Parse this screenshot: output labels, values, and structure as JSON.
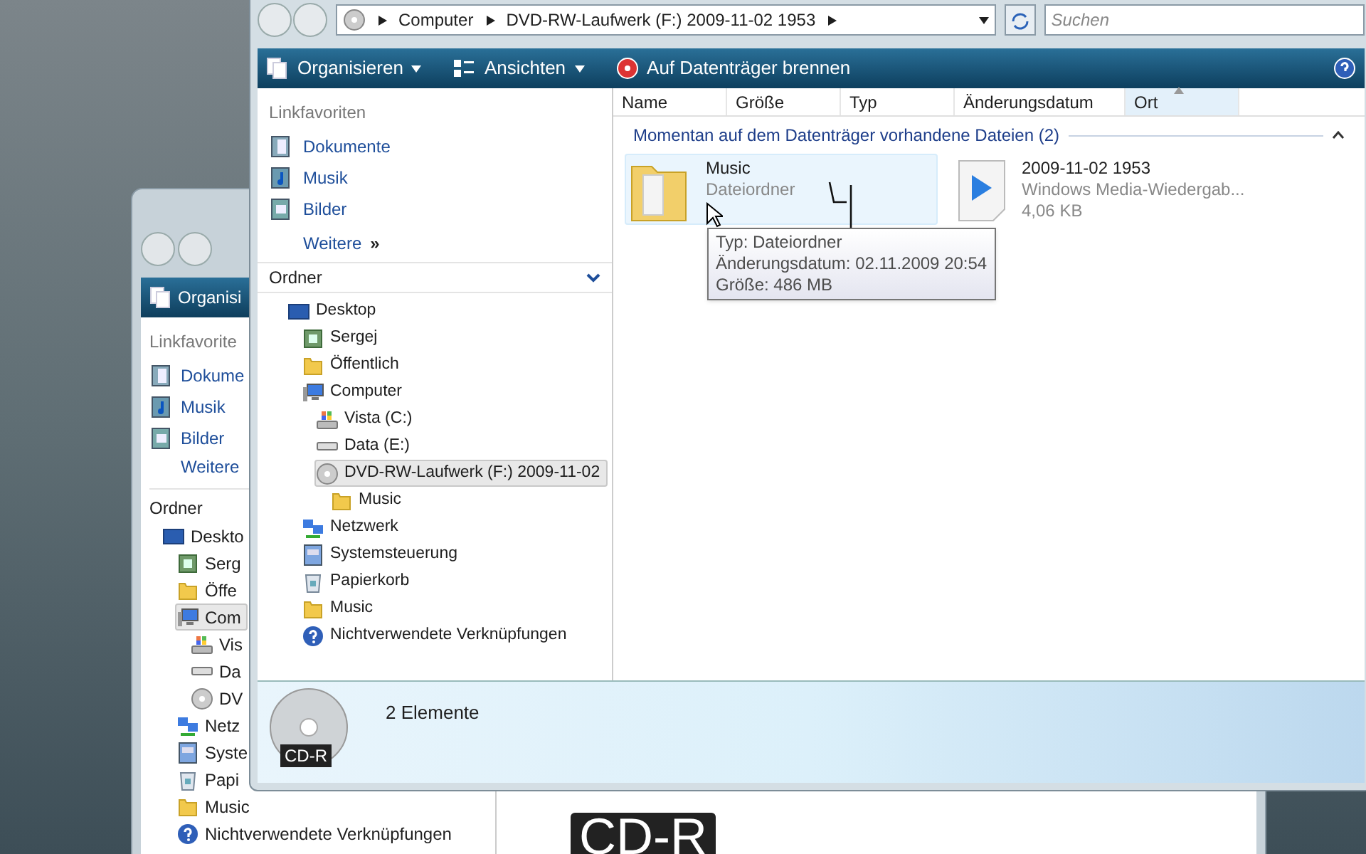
{
  "back_window": {
    "toolbar_button": "Organisi",
    "favorites_title": "Linkfavorite",
    "favorites": [
      {
        "label": "Dokume",
        "kind": "documents"
      },
      {
        "label": "Musik",
        "kind": "music"
      },
      {
        "label": "Bilder",
        "kind": "pictures"
      }
    ],
    "more": "Weitere",
    "folders_title": "Ordner",
    "tree": [
      {
        "label": "Deskto",
        "kind": "desktop",
        "selected": false,
        "children": [
          {
            "label": "Serg",
            "kind": "user",
            "selected": false
          },
          {
            "label": "Öffe",
            "kind": "folder",
            "selected": false
          },
          {
            "label": "Com",
            "kind": "computer",
            "selected": true,
            "children": [
              {
                "label": "Vis",
                "kind": "system-drive",
                "selected": false
              },
              {
                "label": "Da",
                "kind": "drive",
                "selected": false
              },
              {
                "label": "DV",
                "kind": "disc",
                "selected": false
              }
            ]
          },
          {
            "label": "Netz",
            "kind": "network",
            "selected": false
          },
          {
            "label": "Syste",
            "kind": "control-panel",
            "selected": false
          },
          {
            "label": "Papi",
            "kind": "recycle-bin",
            "selected": false
          },
          {
            "label": "Music",
            "kind": "folder",
            "selected": false
          },
          {
            "label": "Nichtverwendete Verknüpfungen",
            "kind": "help",
            "selected": false
          }
        ]
      }
    ],
    "drive_label": "CD-R"
  },
  "front_window": {
    "address": [
      "Computer",
      "DVD-RW-Laufwerk (F:) 2009-11-02 1953"
    ],
    "search": {
      "placeholder": "Suchen"
    },
    "toolbar": [
      {
        "label": "Organisieren",
        "kind": "organize",
        "dropdown": true
      },
      {
        "label": "Ansichten",
        "kind": "views",
        "dropdown": true
      },
      {
        "label": "Auf Datenträger brennen",
        "kind": "burn",
        "dropdown": false
      }
    ],
    "favorites_title": "Linkfavoriten",
    "favorites": [
      {
        "label": "Dokumente",
        "kind": "documents"
      },
      {
        "label": "Musik",
        "kind": "music"
      },
      {
        "label": "Bilder",
        "kind": "pictures"
      }
    ],
    "more": "Weitere",
    "more_glyph": "»",
    "folders_title": "Ordner",
    "tree": [
      {
        "label": "Desktop",
        "kind": "desktop",
        "selected": false,
        "children": [
          {
            "label": "Sergej",
            "kind": "user",
            "selected": false
          },
          {
            "label": "Öffentlich",
            "kind": "folder",
            "selected": false
          },
          {
            "label": "Computer",
            "kind": "computer",
            "selected": false,
            "children": [
              {
                "label": "Vista (C:)",
                "kind": "system-drive",
                "selected": false
              },
              {
                "label": "Data (E:)",
                "kind": "drive",
                "selected": false
              },
              {
                "label": "DVD-RW-Laufwerk (F:) 2009-11-02",
                "kind": "disc",
                "selected": true,
                "children": [
                  {
                    "label": "Music",
                    "kind": "folder",
                    "selected": false
                  }
                ]
              }
            ]
          },
          {
            "label": "Netzwerk",
            "kind": "network",
            "selected": false
          },
          {
            "label": "Systemsteuerung",
            "kind": "control-panel",
            "selected": false
          },
          {
            "label": "Papierkorb",
            "kind": "recycle-bin",
            "selected": false
          },
          {
            "label": "Music",
            "kind": "folder",
            "selected": false
          },
          {
            "label": "Nichtverwendete Verknüpfungen",
            "kind": "help",
            "selected": false
          }
        ]
      }
    ],
    "columns": [
      {
        "label": "Name",
        "sorted": false
      },
      {
        "label": "Größe",
        "sorted": false
      },
      {
        "label": "Typ",
        "sorted": false
      },
      {
        "label": "Änderungsdatum",
        "sorted": false
      },
      {
        "label": "Ort",
        "sorted": true
      }
    ],
    "group": {
      "title": "Momentan auf dem Datenträger vorhandene Dateien (2)",
      "expanded": true
    },
    "files": [
      {
        "name": "Music",
        "kind": "folder",
        "details": [
          "Dateiordner"
        ],
        "hovered": true
      },
      {
        "name": "2009-11-02 1953",
        "kind": "media",
        "details": [
          "Windows Media-Wiedergab...",
          "4,06 KB"
        ],
        "hovered": false
      }
    ],
    "tooltip": [
      "Typ: Dateiordner",
      "Änderungsdatum: 02.11.2009 20:54",
      "Größe: 486 MB"
    ],
    "status": {
      "count": "2 Elemente",
      "drive_label": "CD-R"
    }
  }
}
